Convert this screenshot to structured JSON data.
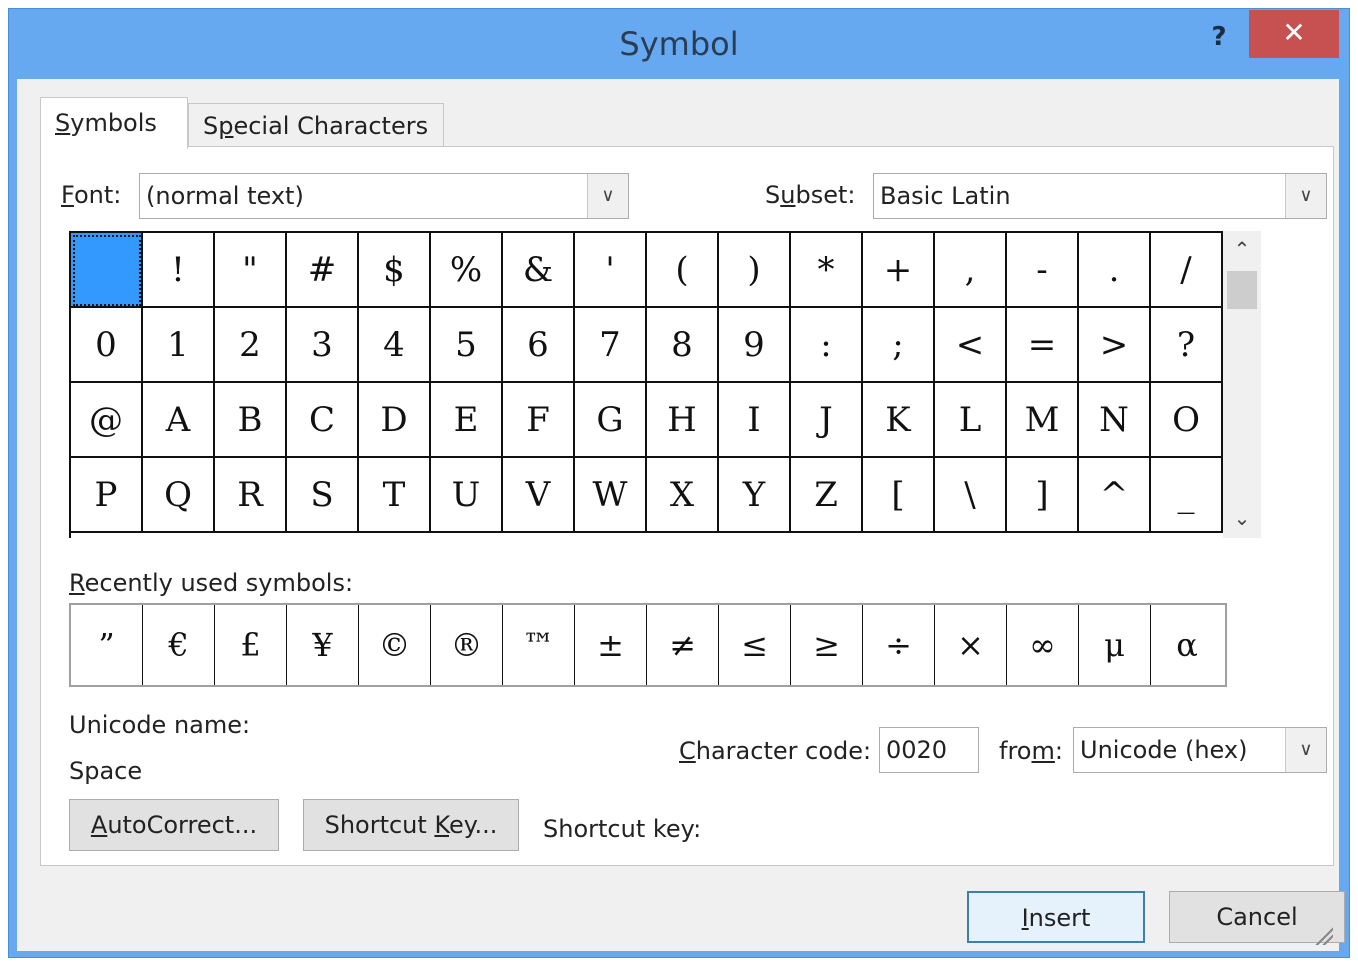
{
  "window": {
    "title": "Symbol",
    "help_label": "?",
    "close_label": "✕"
  },
  "tabs": [
    {
      "label_pre": "",
      "label_u": "S",
      "label_post": "ymbols"
    },
    {
      "label_pre": "S",
      "label_u": "p",
      "label_post": "ecial Characters"
    }
  ],
  "font": {
    "label_u": "F",
    "label_post": "ont:",
    "value": "(normal text)"
  },
  "subset": {
    "label_pre": "S",
    "label_u": "u",
    "label_post": "bset:",
    "value": "Basic Latin"
  },
  "symbols": [
    " ",
    "!",
    "\"",
    "#",
    "$",
    "%",
    "&",
    "'",
    "(",
    ")",
    "*",
    "+",
    ",",
    "-",
    ".",
    "/",
    "0",
    "1",
    "2",
    "3",
    "4",
    "5",
    "6",
    "7",
    "8",
    "9",
    ":",
    ";",
    "<",
    "=",
    ">",
    "?",
    "@",
    "A",
    "B",
    "C",
    "D",
    "E",
    "F",
    "G",
    "H",
    "I",
    "J",
    "K",
    "L",
    "M",
    "N",
    "O",
    "P",
    "Q",
    "R",
    "S",
    "T",
    "U",
    "V",
    "W",
    "X",
    "Y",
    "Z",
    "[",
    "\\",
    "]",
    "^",
    "_"
  ],
  "recent": {
    "label_u": "R",
    "label_post": "ecently used symbols:",
    "items": [
      "”",
      "€",
      "£",
      "¥",
      "©",
      "®",
      "™",
      "±",
      "≠",
      "≤",
      "≥",
      "÷",
      "×",
      "∞",
      "μ",
      "α"
    ]
  },
  "unicode": {
    "name_label": "Unicode name:",
    "name_value": "Space"
  },
  "charcode": {
    "label_u": "C",
    "label_post": "haracter code:",
    "value": "0020"
  },
  "from": {
    "label_pre": "fro",
    "label_u": "m",
    "label_post": ":",
    "value": "Unicode (hex)"
  },
  "buttons": {
    "autocorrect": {
      "u": "A",
      "post": "utoCorrect..."
    },
    "shortcut": {
      "pre": "Shortcut ",
      "u": "K",
      "post": "ey..."
    },
    "insert": {
      "u": "I",
      "post": "nsert"
    },
    "cancel": "Cancel"
  },
  "shortcut_key_label": "Shortcut key:",
  "icons": {
    "dropdown": "chevron-down-icon",
    "scroll_up": "chevron-up-icon",
    "scroll_down": "chevron-down-icon",
    "close": "close-icon",
    "help": "help-icon",
    "grip": "resize-grip-icon"
  },
  "colors": {
    "titlebar": "#66a9f0",
    "close": "#c75050",
    "selection": "#3399ff"
  }
}
